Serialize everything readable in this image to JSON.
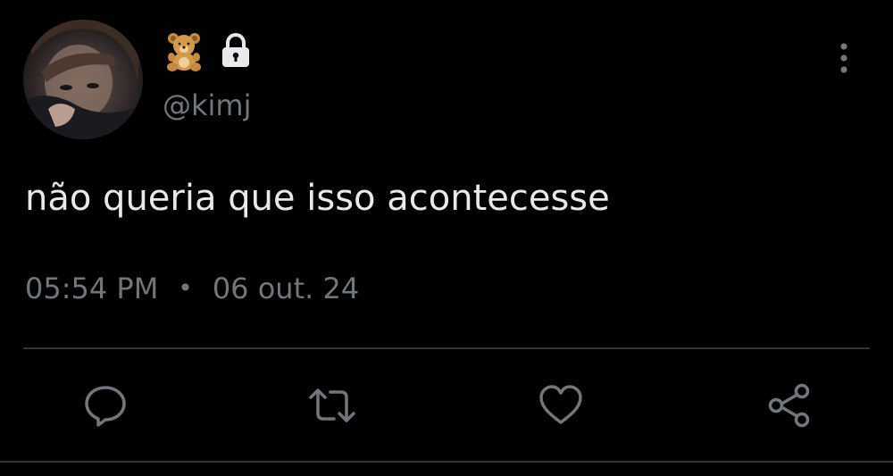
{
  "tweet": {
    "handle": "@kimj",
    "text": "não queria que isso acontecesse",
    "time": "05:54 PM",
    "separator": "•",
    "date": "06 out. 24"
  },
  "icons": {
    "badge": "teddy-bear-emoji",
    "lock": "lock-icon",
    "more": "vertical-ellipsis-icon",
    "reply": "reply-icon",
    "retweet": "retweet-icon",
    "like": "heart-icon",
    "share": "share-icon"
  },
  "colors": {
    "background": "#000000",
    "text": "#e7e9ea",
    "muted": "#71767b",
    "divider": "#2f3336"
  }
}
